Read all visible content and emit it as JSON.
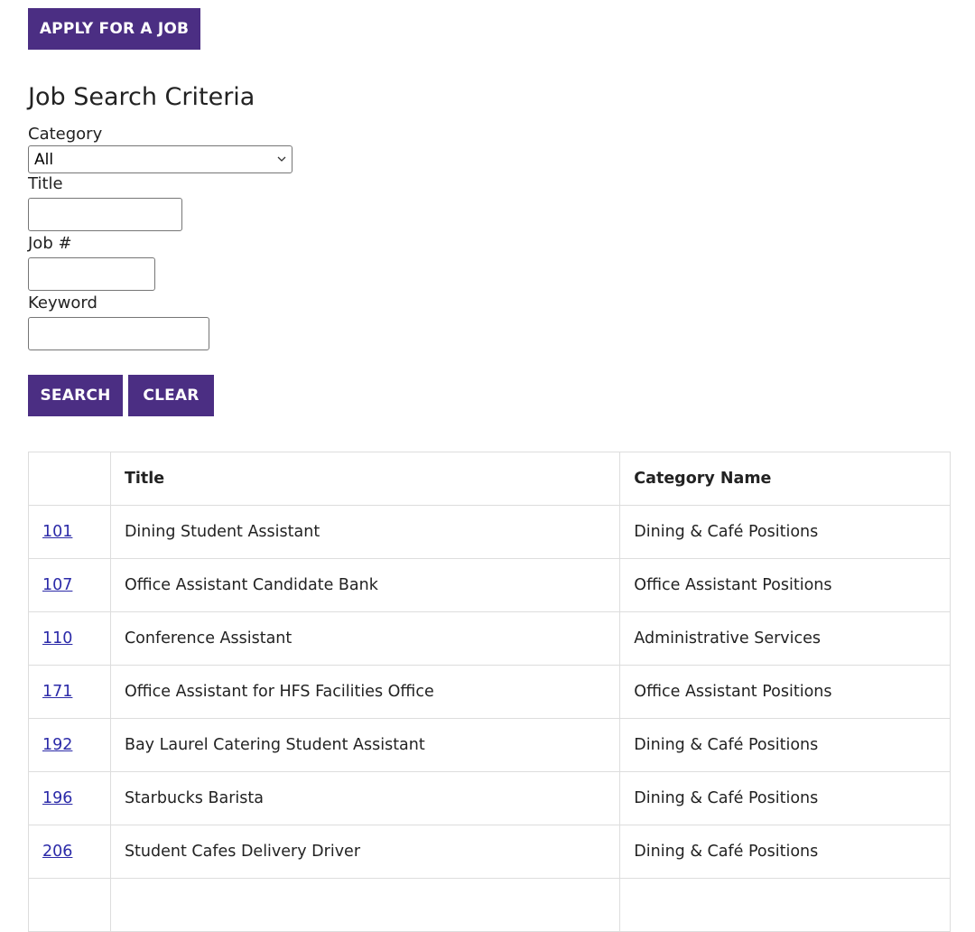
{
  "header": {
    "apply_label": "APPLY FOR A JOB"
  },
  "criteria": {
    "heading": "Job Search Criteria",
    "category_label": "Category",
    "category_selected": "All",
    "title_label": "Title",
    "title_value": "",
    "jobnum_label": "Job #",
    "jobnum_value": "",
    "keyword_label": "Keyword",
    "keyword_value": ""
  },
  "actions": {
    "search_label": "SEARCH",
    "clear_label": "CLEAR"
  },
  "table": {
    "headers": [
      "",
      "Title",
      "Category Name"
    ],
    "rows": [
      {
        "num": "101",
        "title": "Dining Student Assistant",
        "category": "Dining & Café Positions"
      },
      {
        "num": "107",
        "title": "Office Assistant Candidate Bank",
        "category": "Office Assistant Positions"
      },
      {
        "num": "110",
        "title": "Conference Assistant",
        "category": "Administrative Services"
      },
      {
        "num": "171",
        "title": "Office Assistant for HFS Facilities Office",
        "category": "Office Assistant Positions"
      },
      {
        "num": "192",
        "title": "Bay Laurel Catering Student Assistant",
        "category": "Dining & Café Positions"
      },
      {
        "num": "196",
        "title": "Starbucks Barista",
        "category": "Dining & Café Positions"
      },
      {
        "num": "206",
        "title": "Student Cafes Delivery Driver",
        "category": "Dining & Café Positions"
      }
    ]
  },
  "colors": {
    "button_bg": "#4b2e83",
    "link": "#2b2aa8",
    "border": "#dddddd"
  },
  "icons": {
    "select_arrow": "chevron-down-icon"
  }
}
